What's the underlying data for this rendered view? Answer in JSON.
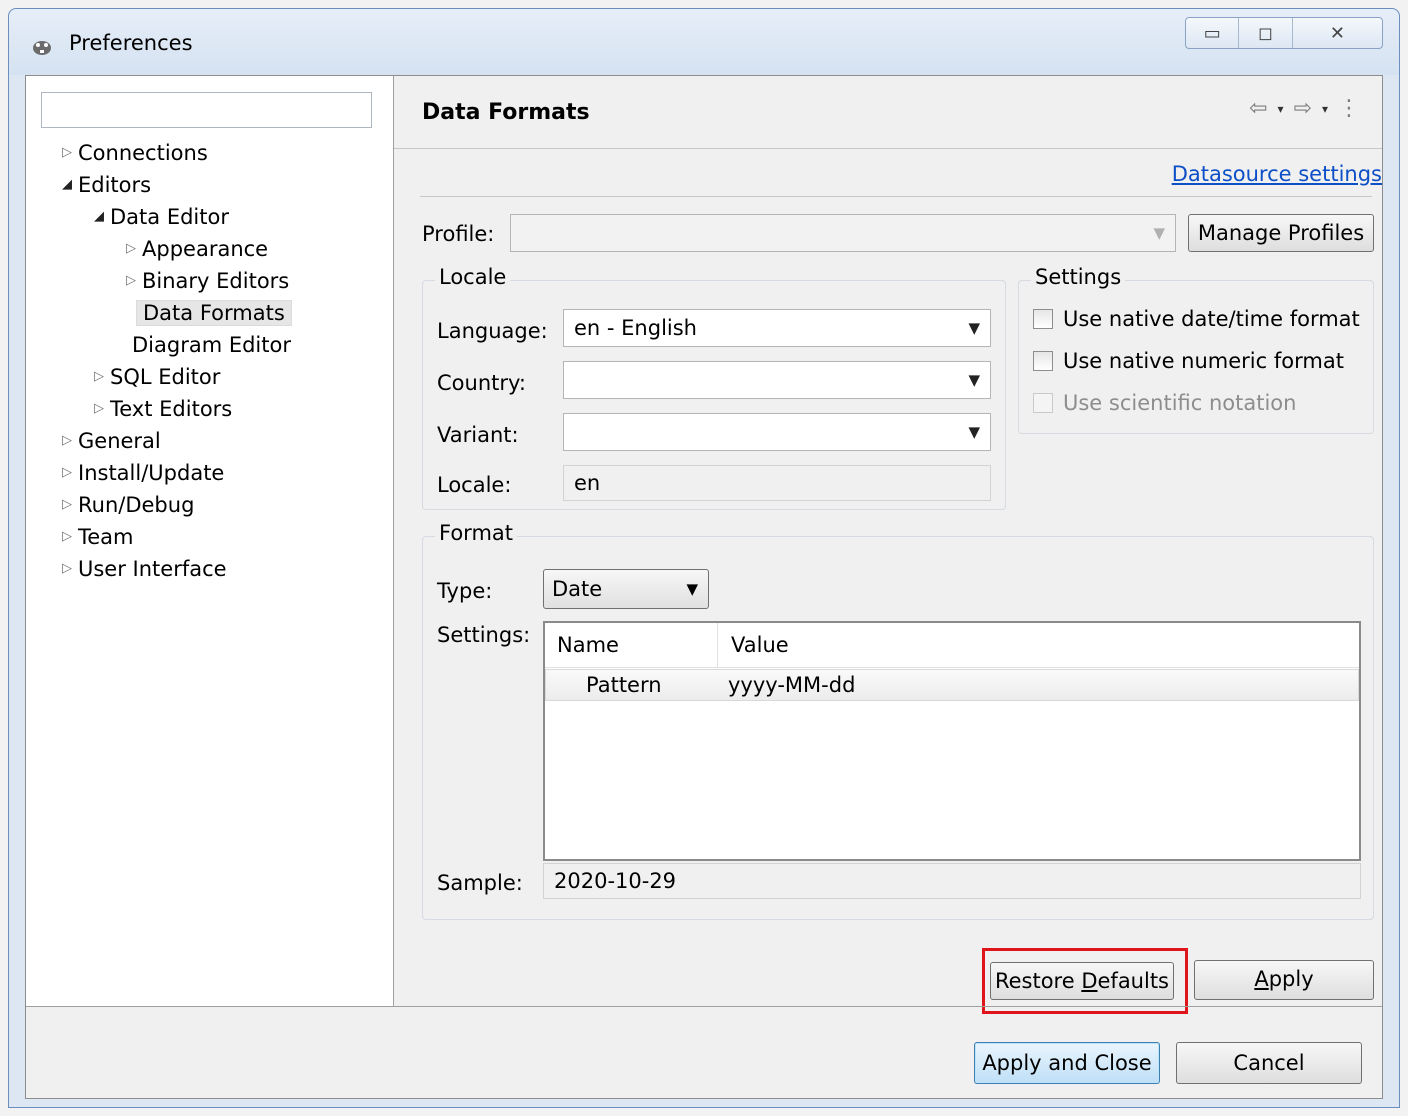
{
  "window": {
    "title": "Preferences",
    "icon": "dbeaver-beaver-icon",
    "controls": {
      "minimize": "▭",
      "maximize": "◻",
      "close": "✕"
    }
  },
  "nav": {
    "search_placeholder": "",
    "items": [
      {
        "label": "Connections",
        "expanded": false
      },
      {
        "label": "Editors",
        "expanded": true
      },
      {
        "label": "Data Editor",
        "expanded": true
      },
      {
        "label": "Appearance",
        "expanded": false
      },
      {
        "label": "Binary Editors",
        "expanded": false
      },
      {
        "label": "Data Formats",
        "selected": true
      },
      {
        "label": "Diagram Editor"
      },
      {
        "label": "SQL Editor",
        "expanded": false
      },
      {
        "label": "Text Editors",
        "expanded": false
      },
      {
        "label": "General",
        "expanded": false
      },
      {
        "label": "Install/Update",
        "expanded": false
      },
      {
        "label": "Run/Debug",
        "expanded": false
      },
      {
        "label": "Team",
        "expanded": false
      },
      {
        "label": "User Interface",
        "expanded": false
      }
    ]
  },
  "page": {
    "title": "Data Formats",
    "datasource_link": "Datasource settings",
    "profile_label": "Profile:",
    "profile_value": "",
    "manage_profiles": "Manage Profiles",
    "locale_group": "Locale",
    "language_label": "Language:",
    "language_value": "en - English",
    "country_label": "Country:",
    "country_value": "",
    "variant_label": "Variant:",
    "variant_value": "",
    "locale_label": "Locale:",
    "locale_value": "en",
    "settings_group": "Settings",
    "cb_native_datetime": "Use native date/time format",
    "cb_native_numeric": "Use native numeric format",
    "cb_scientific": "Use scientific notation",
    "format_group": "Format",
    "type_label": "Type:",
    "type_value": "Date",
    "settings_label": "Settings:",
    "table_headers": [
      "Name",
      "Value"
    ],
    "table_rows": [
      {
        "name": "Pattern",
        "value": "yyyy-MM-dd"
      }
    ],
    "sample_label": "Sample:",
    "sample_value": "2020-10-29"
  },
  "buttons": {
    "restore_defaults_pre": "Restore ",
    "restore_defaults_mn": "D",
    "restore_defaults_post": "efaults",
    "apply_mn": "A",
    "apply_post": "pply",
    "apply_close": "Apply and Close",
    "cancel": "Cancel"
  },
  "nav_arrows": {
    "back": "⇦",
    "forward": "⇨",
    "menu": "⋮",
    "dropdown": "▾"
  },
  "colors": {
    "link": "#0c4fc7",
    "highlight": "#e0141b",
    "default_button": "#3c7fb1"
  }
}
